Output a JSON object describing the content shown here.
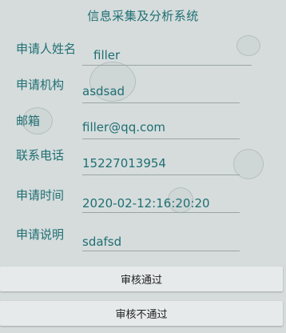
{
  "title": "信息采集及分析系统",
  "fields": [
    {
      "label": "申请人姓名",
      "value": "filler"
    },
    {
      "label": "申请机构",
      "value": "asdsad"
    },
    {
      "label": "邮箱",
      "value": "filler@qq.com"
    },
    {
      "label": "联系电话",
      "value": "15227013954"
    },
    {
      "label": "申请时间",
      "value": "2020-02-12:16:20:20"
    },
    {
      "label": "申请说明",
      "value": "sdafsd"
    }
  ],
  "buttons": {
    "approve": "审核通过",
    "reject": "审核不通过"
  }
}
